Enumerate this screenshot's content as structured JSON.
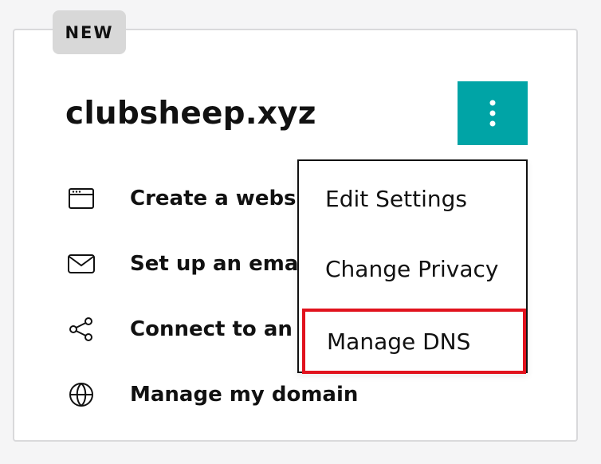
{
  "card": {
    "badge": "NEW",
    "domain": "clubsheep.xyz"
  },
  "actions": [
    {
      "label": "Create a website",
      "icon": "browser-window-icon"
    },
    {
      "label": "Set up an email",
      "icon": "envelope-icon"
    },
    {
      "label": "Connect to an existing site",
      "icon": "share-nodes-icon"
    },
    {
      "label": "Manage my domain",
      "icon": "globe-icon"
    }
  ],
  "menu": {
    "items": [
      {
        "label": "Edit Settings"
      },
      {
        "label": "Change Privacy"
      },
      {
        "label": "Manage DNS",
        "highlighted": true
      }
    ]
  },
  "colors": {
    "accent_button": "#00a4a6",
    "highlight_border": "#e1121d",
    "badge_background": "#d8d8d8"
  }
}
